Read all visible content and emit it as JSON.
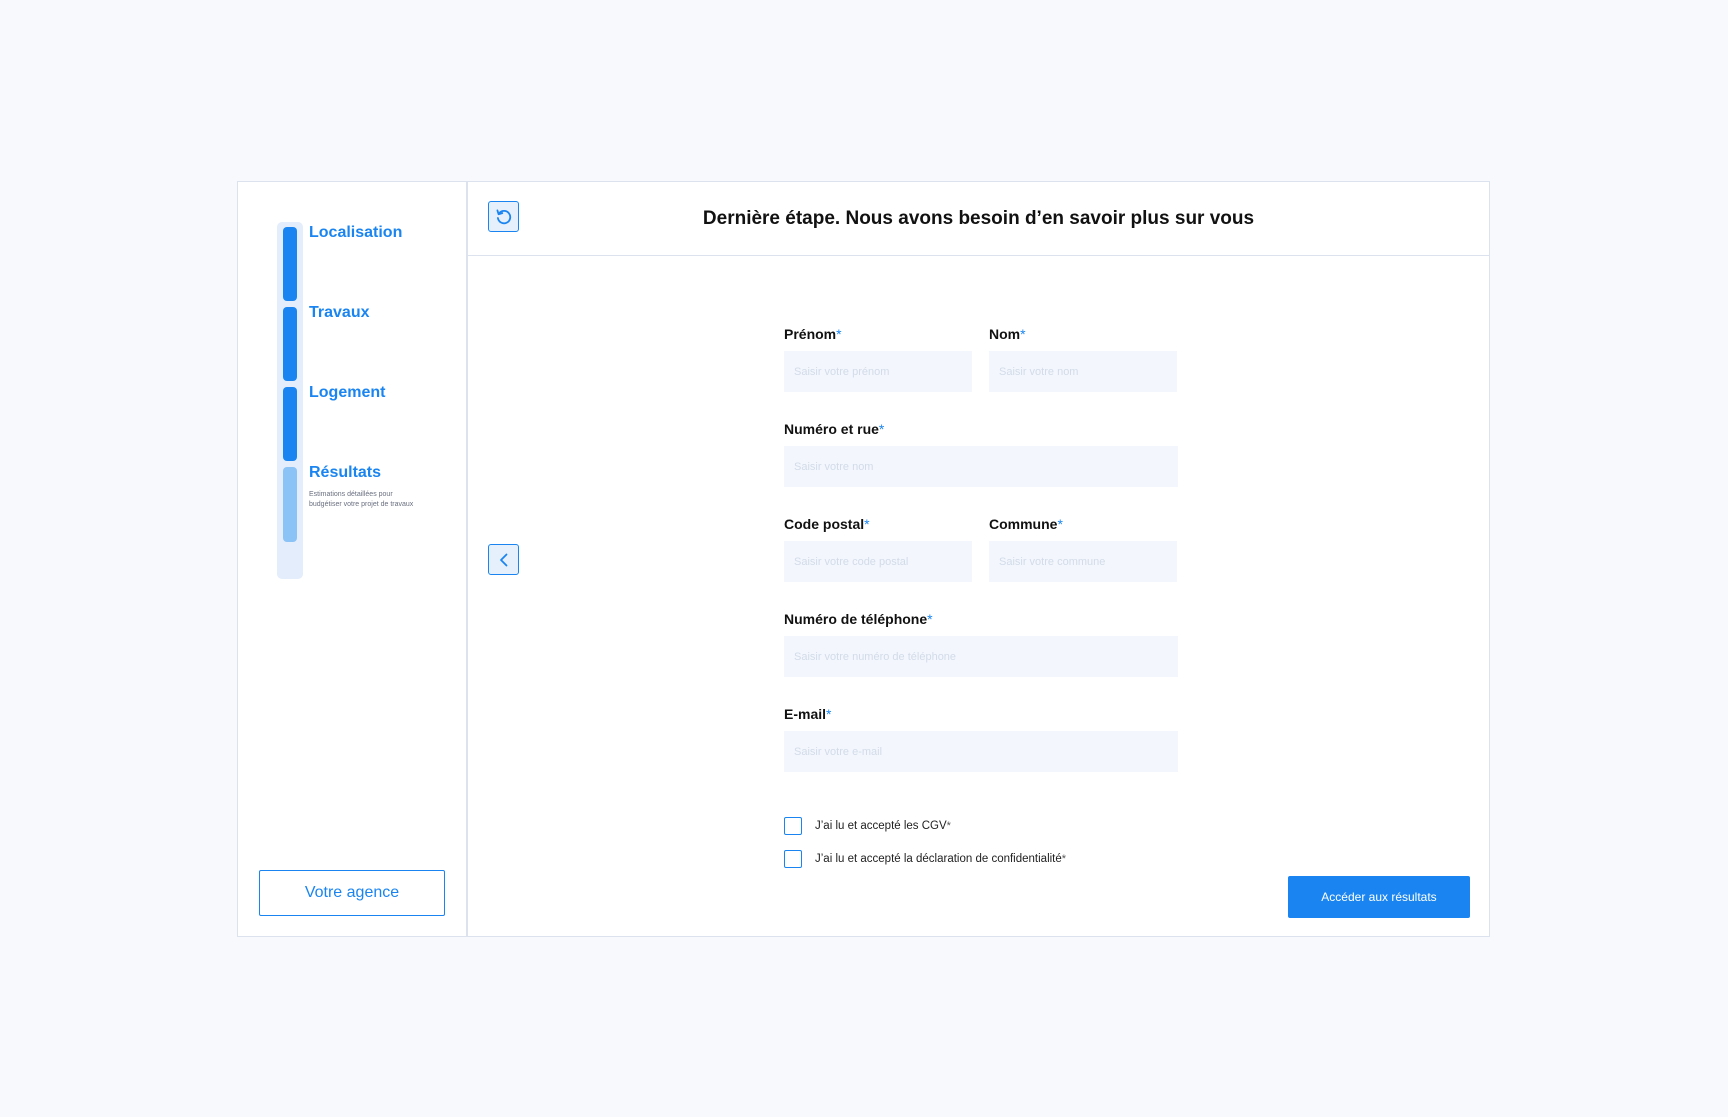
{
  "sidebar": {
    "steps": [
      {
        "label": "Localisation",
        "state": "done"
      },
      {
        "label": "Travaux",
        "state": "done"
      },
      {
        "label": "Logement",
        "state": "done"
      },
      {
        "label": "Résultats",
        "state": "current",
        "description": "Estimations détaillées pour budgétiser votre projet de travaux"
      }
    ],
    "agency_button": "Votre agence"
  },
  "header": {
    "title": "Dernière étape. Nous avons besoin d’en savoir plus sur vous",
    "reset_icon": "refresh-icon"
  },
  "navigation": {
    "back_icon": "chevron-left-icon"
  },
  "form": {
    "required_mark": "*",
    "firstname": {
      "label": "Prénom",
      "placeholder": "Saisir votre prénom",
      "value": ""
    },
    "lastname": {
      "label": "Nom",
      "placeholder": "Saisir votre nom",
      "value": ""
    },
    "street": {
      "label": "Numéro et rue",
      "placeholder": "Saisir votre nom",
      "value": ""
    },
    "postal_code": {
      "label": "Code postal",
      "placeholder": "Saisir votre code postal",
      "value": ""
    },
    "city": {
      "label": "Commune",
      "placeholder": "Saisir votre commune",
      "value": ""
    },
    "phone": {
      "label": "Numéro de téléphone",
      "placeholder": "Saisir votre numéro de téléphone",
      "value": ""
    },
    "email": {
      "label": "E-mail",
      "placeholder": "Saisir votre e-mail",
      "value": ""
    },
    "checkboxes": [
      {
        "label": "J’ai lu et accepté les CGV",
        "checked": false
      },
      {
        "label": "J’ai lu et accepté la déclaration de confidentialité",
        "checked": false
      }
    ],
    "submit_label": "Accéder aux résultats"
  },
  "colors": {
    "accent": "#1a85f0",
    "accent_light": "#8cc3f6",
    "track": "#e4edfb",
    "background": "#f7f9fd",
    "input_bg": "#f3f7fd"
  }
}
